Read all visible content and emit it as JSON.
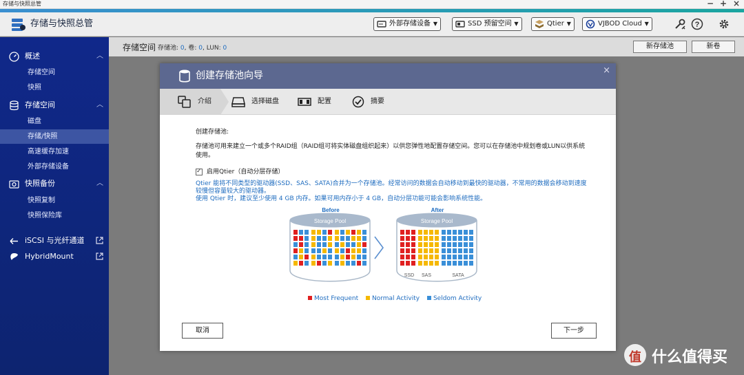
{
  "titlebar": {
    "title": "存储与快照总管",
    "minimize": "−",
    "maximize": "+",
    "close": "×"
  },
  "app": {
    "title": "存储与快照总管"
  },
  "header_buttons": [
    {
      "label": "外部存储设备"
    },
    {
      "label": "SSD 预留空间"
    },
    {
      "label": "Qtier"
    },
    {
      "label": "VJBOD Cloud"
    }
  ],
  "header_icons": [
    "tools-icon",
    "help-icon",
    "gear-icon"
  ],
  "sidebar": {
    "groups": [
      {
        "label": "概述",
        "icon": "dashboard-icon",
        "items": [
          {
            "label": "存储空间"
          },
          {
            "label": "快照"
          }
        ]
      },
      {
        "label": "存储空间",
        "icon": "database-icon",
        "items": [
          {
            "label": "磁盘"
          },
          {
            "label": "存储/快照",
            "active": true
          },
          {
            "label": "高速缓存加速"
          },
          {
            "label": "外部存储设备"
          }
        ]
      },
      {
        "label": "快照备份",
        "icon": "snapshot-icon",
        "items": [
          {
            "label": "快照复制"
          },
          {
            "label": "快照保险库"
          }
        ]
      }
    ],
    "links": [
      {
        "label": "iSCSI 与光纤通道",
        "icon": "iscsi-icon"
      },
      {
        "label": "HybridMount",
        "icon": "hybridmount-icon"
      }
    ]
  },
  "content": {
    "title": "存储空间",
    "stats_prefix": "存储池:",
    "pools": "0",
    "volumes_label": ", 卷:",
    "volumes": "0",
    "luns_label": ", LUN:",
    "luns": "0",
    "new_pool": "新存储池",
    "new_volume": "新卷"
  },
  "dialog": {
    "title": "创建存储池向导",
    "close": "×",
    "steps": [
      {
        "label": "介绍",
        "icon": "intro-icon",
        "active": true
      },
      {
        "label": "选择磁盘",
        "icon": "disk-icon"
      },
      {
        "label": "配置",
        "icon": "config-icon"
      },
      {
        "label": "摘要",
        "icon": "check-icon"
      }
    ],
    "heading": "创建存储池:",
    "description": "存储池可用来建立一个或多个RAID组（RAID组可将实体磁盘组织起来）以供您弹性地配置存储空间。您可以在存储池中规划卷或LUN以供系统使用。",
    "qtier_label": "启用Qtier（自动分层存储）",
    "qtier_checked": true,
    "qtier_info_1": "Qtier 能将不同类型的驱动器(SSD、SAS、SATA)合并为一个存储池。经常访问的数据会自动移动到最快的驱动器，不常用的数据会移动到速度较慢但容量较大的驱动器。",
    "qtier_info_2": "使用 Qtier 时，建议至少使用 4 GB 内存。如果可用内存小于 4 GB，自动分层功能可能会影响系统性能。",
    "diagram": {
      "before": "Before",
      "after": "After",
      "pool_label": "Storage Pool",
      "tiers": [
        "SSD",
        "SAS",
        "SATA"
      ]
    },
    "legend": [
      {
        "label": "Most Frequent",
        "color": "#e02020"
      },
      {
        "label": "Normal Activity",
        "color": "#f5b800"
      },
      {
        "label": "Seldom Activity",
        "color": "#3a8fd8"
      }
    ],
    "cancel": "取消",
    "next": "下一步"
  },
  "watermark": {
    "text": "什么值得买"
  }
}
